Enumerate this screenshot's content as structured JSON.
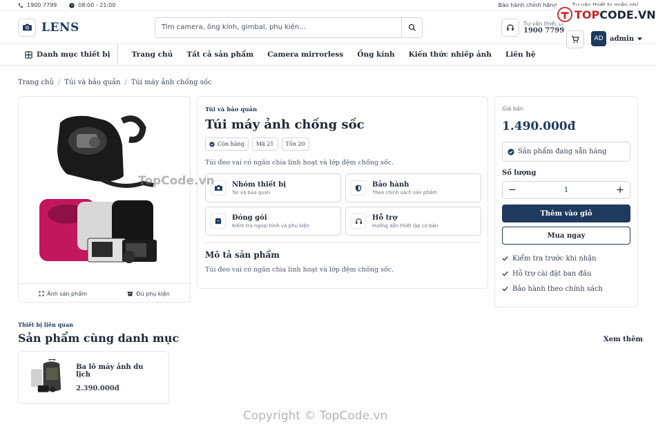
{
  "topbar": {
    "phone": "1900 7799",
    "hours": "08:00 - 21:00",
    "links": [
      "Bảo hành chính hãng",
      "Tư vấn thiết bị miễn phí"
    ]
  },
  "header": {
    "logo": "LENS",
    "search_placeholder": "Tìm camera, ống kính, gimbal, phụ kiện...",
    "hotline_label": "Tư vấn thiết bị",
    "hotline_number": "1900 7799",
    "avatar_initials": "AD",
    "username": "admin"
  },
  "nav": {
    "category": "Danh mục thiết bị",
    "items": [
      "Trang chủ",
      "Tất cả sản phẩm",
      "Camera mirrorless",
      "Ống kính",
      "Kiến thức nhiếp ảnh",
      "Liên hệ"
    ]
  },
  "breadcrumb": [
    "Trang chủ",
    "Túi và bảo quản",
    "Túi máy ảnh chống sốc"
  ],
  "gallery": {
    "photo_label": "Ảnh sản phẩm",
    "accessory_label": "Đủ phụ kiện"
  },
  "product": {
    "category": "Túi và bảo quản",
    "name": "Túi máy ảnh chống sốc",
    "tags": [
      "Còn hàng",
      "Mã 21",
      "Tồn 20"
    ],
    "short_desc": "Túi đeo vai có ngăn chia linh hoạt và lớp đệm chống sốc.",
    "features": [
      {
        "title": "Nhóm thiết bị",
        "sub": "Túi và bảo quản"
      },
      {
        "title": "Bảo hành",
        "sub": "Theo chính sách sản phẩm"
      },
      {
        "title": "Đóng gói",
        "sub": "Kiểm tra ngoại hình và phụ kiện"
      },
      {
        "title": "Hỗ trợ",
        "sub": "Hướng dẫn thiết lập cơ bản"
      }
    ],
    "desc_title": "Mô tả sản phẩm",
    "desc": "Túi đeo vai có ngăn chia linh hoạt và lớp đệm chống sốc."
  },
  "buy": {
    "price_label": "Giá bán",
    "price": "1.490.000đ",
    "stock": "Sản phẩm đang sẵn hàng",
    "qty_label": "Số lượng",
    "qty": "1",
    "minus": "−",
    "plus": "+",
    "add_cart": "Thêm vào giỏ",
    "buy_now": "Mua ngay",
    "perks": [
      "Kiểm tra trước khi nhận",
      "Hỗ trợ cài đặt ban đầu",
      "Bảo hành theo chính sách"
    ]
  },
  "related": {
    "label": "Thiết bị liên quan",
    "title": "Sản phẩm cùng danh mục",
    "see_all": "Xem thêm",
    "items": [
      {
        "name": "Ba lô máy ảnh du lịch",
        "price": "2.390.000đ"
      }
    ]
  },
  "watermark": {
    "logo_prefix": "TOP",
    "logo_suffix": "CODE.VN",
    "mid": "TopCode.vn",
    "copyright": "Copyright © TopCode.vn"
  },
  "colors": {
    "primary": "#1e3a5f",
    "border": "#e5e7eb",
    "accent": "#c62828"
  }
}
